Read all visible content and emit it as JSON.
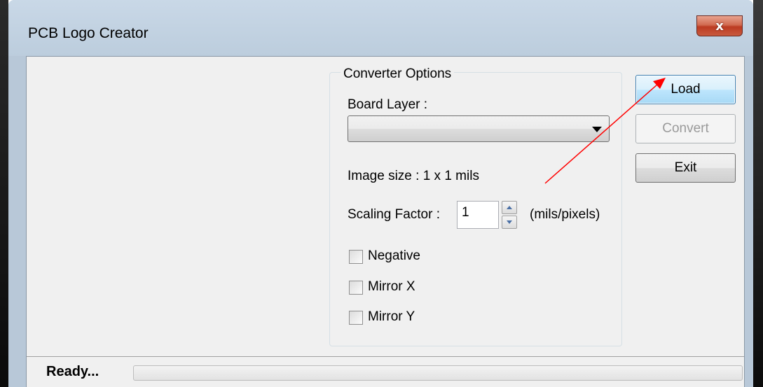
{
  "window": {
    "title": "PCB Logo Creator",
    "close_glyph": "x"
  },
  "converter_options": {
    "group_title": "Converter Options",
    "board_layer_label": "Board Layer :",
    "board_layer_value": "",
    "image_size_text": "Image size : 1 x 1 mils",
    "scaling_label": "Scaling Factor :",
    "scaling_value": "1",
    "scaling_unit": "(mils/pixels)",
    "checkboxes": [
      {
        "label": "Negative",
        "checked": false
      },
      {
        "label": "Mirror X",
        "checked": false
      },
      {
        "label": "Mirror Y",
        "checked": false
      }
    ]
  },
  "buttons": {
    "load": "Load",
    "convert": "Convert",
    "exit": "Exit"
  },
  "status": {
    "text": "Ready...",
    "progress": 0
  },
  "colors": {
    "annotation_arrow": "#ff0000",
    "load_button_border": "#3c7fb1"
  }
}
